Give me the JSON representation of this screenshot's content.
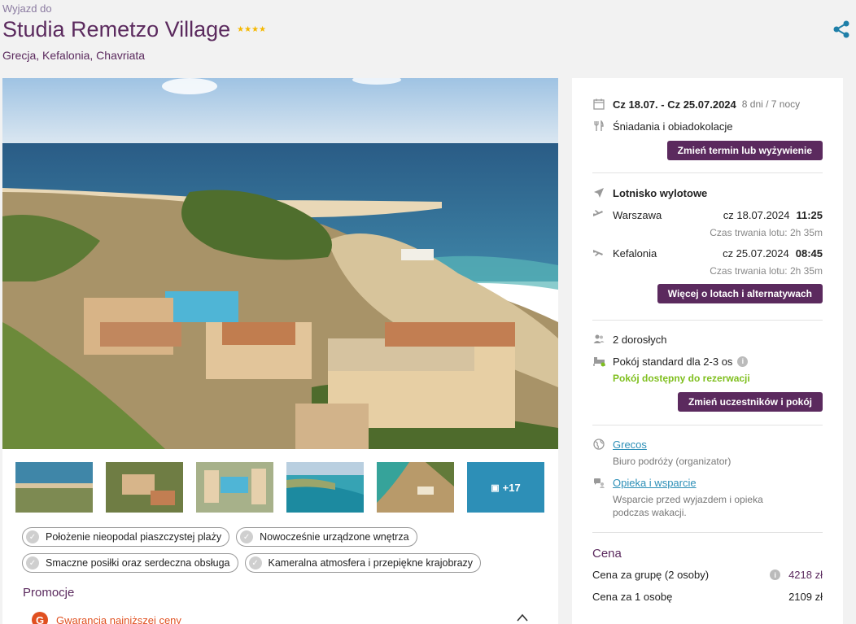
{
  "header": {
    "eyebrow": "Wyjazd do",
    "title": "Studia Remetzo Village",
    "stars": "★★★★",
    "location": "Grecja, Kefalonia, Chavriata"
  },
  "gallery": {
    "more_label": "+17"
  },
  "features": [
    "Położenie nieopodal piaszczystej plaży",
    "Nowocześnie urządzone wnętrza",
    "Smaczne posiłki oraz serdeczna obsługa",
    "Kameralna atmosfera i przepiękne krajobrazy"
  ],
  "promotions": {
    "title": "Promocje",
    "item": "Gwarancja najniższej ceny"
  },
  "booking": {
    "dates": "Cz 18.07. - Cz 25.07.2024",
    "duration": "8 dni / 7 nocy",
    "board": "Śniadania i obiadokolacje",
    "change_date_button": "Zmień termin lub wyżywienie",
    "airport_title": "Lotnisko wylotowe",
    "outbound": {
      "city": "Warszawa",
      "date": "cz 18.07.2024",
      "time": "11:25",
      "duration": "Czas trwania lotu: 2h 35m"
    },
    "return": {
      "city": "Kefalonia",
      "date": "cz 25.07.2024",
      "time": "08:45",
      "duration": "Czas trwania lotu: 2h 35m"
    },
    "flights_button": "Więcej o lotach i alternatywach",
    "guests": "2 dorosłych",
    "room": "Pokój standard dla 2-3 os",
    "room_status": "Pokój dostępny do rezerwacji",
    "change_guests_button": "Zmień uczestników i pokój",
    "organizer_name": "Grecos",
    "organizer_desc": "Biuro podróży (organizator)",
    "support_link": "Opieka i wsparcie",
    "support_desc": "Wsparcie przed wyjazdem i opieka podczas wakacji."
  },
  "price": {
    "title": "Cena",
    "group_label": "Cena za grupę (2 osoby)",
    "group_value": "4218 zł",
    "person_label": "Cena za 1 osobę",
    "person_value": "2109 zł"
  },
  "colors": {
    "brand": "#5b2a5e",
    "link": "#2d8fb7",
    "available": "#7fbf1e",
    "promo": "#e05020"
  }
}
